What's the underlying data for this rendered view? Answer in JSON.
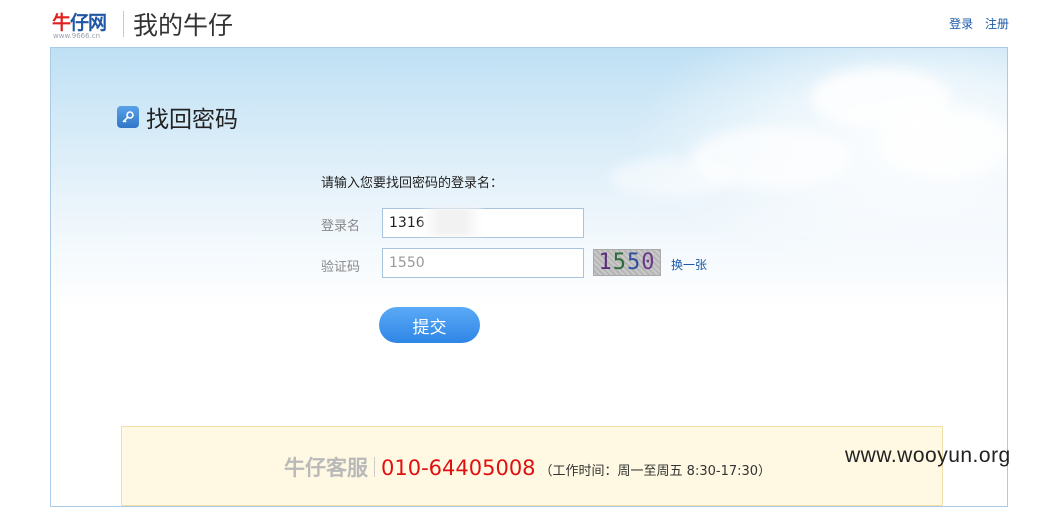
{
  "header": {
    "logo_text_part1": "牛",
    "logo_text_part2": "仔网",
    "logo_url": "www.9666.cn",
    "site_title": "我的牛仔",
    "links": {
      "login": "登录",
      "register": "注册"
    }
  },
  "form": {
    "title": "找回密码",
    "prompt": "请输入您要找回密码的登录名：",
    "username_label": "登录名",
    "username_value": "1316",
    "captcha_label": "验证码",
    "captcha_value": "1550",
    "captcha_placeholder": "",
    "captcha_image_text": [
      "1",
      "5",
      "5",
      "0"
    ],
    "refresh_label": "换一张",
    "submit_label": "提交"
  },
  "service": {
    "name": "牛仔客服",
    "phone": "010-64405008",
    "hours": "（工作时间：周一至周五 8:30-17:30）"
  },
  "watermark": "www.wooyun.org",
  "colors": {
    "accent": "#2f86e6",
    "link": "#1a5aa8",
    "phone": "#e01010"
  }
}
